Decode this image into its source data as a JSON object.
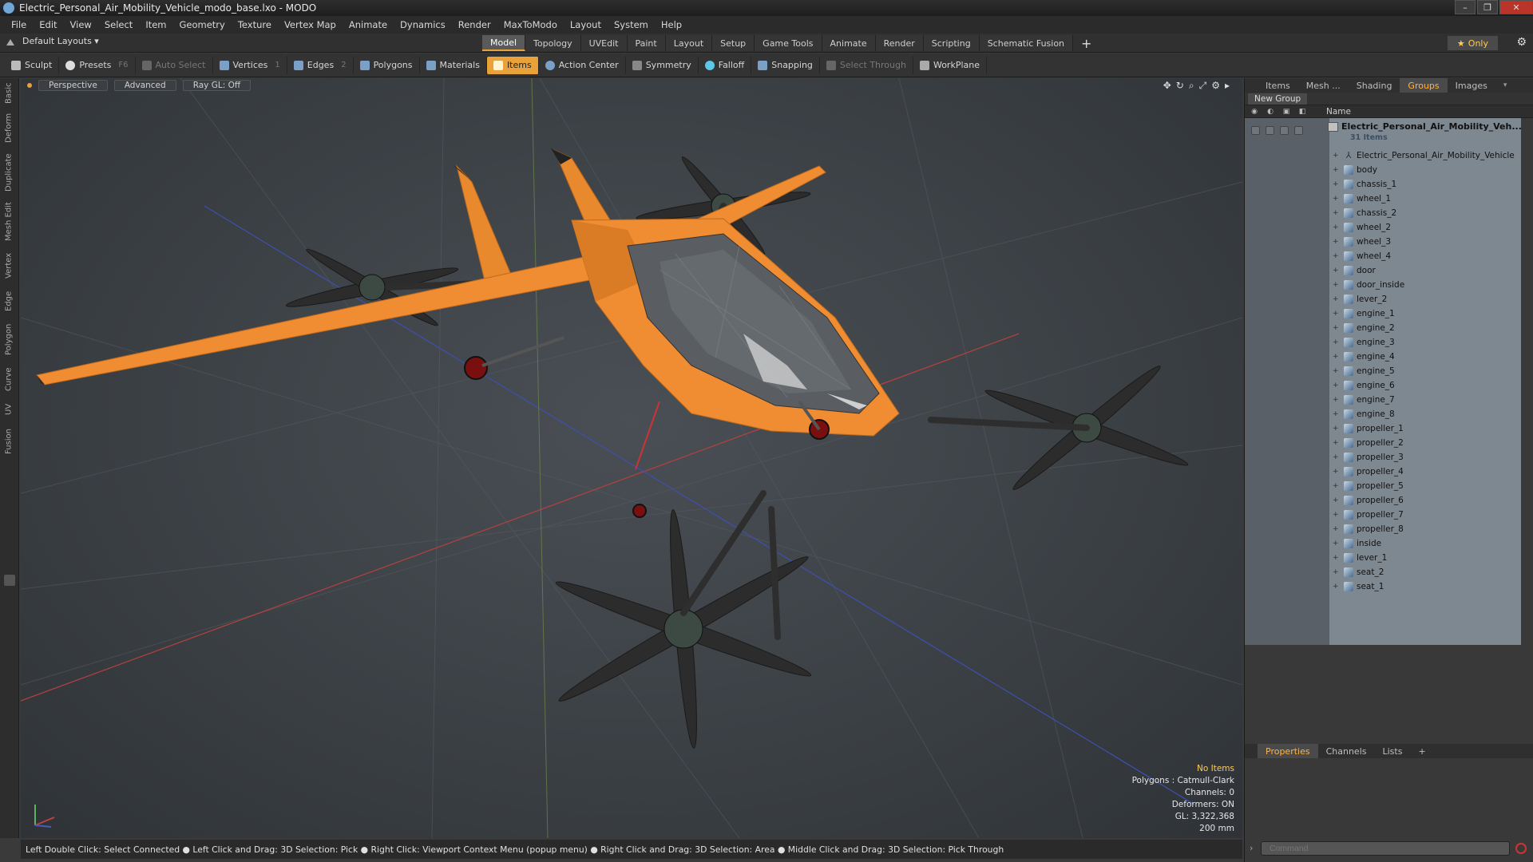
{
  "window": {
    "title": "Electric_Personal_Air_Mobility_Vehicle_modo_base.lxo - MODO"
  },
  "menu": [
    "File",
    "Edit",
    "View",
    "Select",
    "Item",
    "Geometry",
    "Texture",
    "Vertex Map",
    "Animate",
    "Dynamics",
    "Render",
    "MaxToModo",
    "Layout",
    "System",
    "Help"
  ],
  "layouts": {
    "label": "Default Layouts ▾"
  },
  "main_tabs": [
    "Model",
    "Topology",
    "UVEdit",
    "Paint",
    "Layout",
    "Setup",
    "Game Tools",
    "Animate",
    "Render",
    "Scripting",
    "Schematic Fusion"
  ],
  "active_tab": "Model",
  "only_label": "Only",
  "toolbar": {
    "sculpt": "Sculpt",
    "presets": "Presets",
    "presets_key": "F6",
    "auto_select": "Auto Select",
    "vertices": "Vertices",
    "vertices_key": "1",
    "edges": "Edges",
    "edges_key": "2",
    "polygons": "Polygons",
    "materials": "Materials",
    "items": "Items",
    "action_center": "Action Center",
    "symmetry": "Symmetry",
    "falloff": "Falloff",
    "snapping": "Snapping",
    "select_through": "Select Through",
    "workplane": "WorkPlane"
  },
  "left_tabs": [
    "Basic",
    "Deform",
    "Duplicate",
    "Mesh Edit",
    "Vertex",
    "Edge",
    "Polygon",
    "Curve",
    "UV",
    "Fusion"
  ],
  "viewport": {
    "view": "Perspective",
    "shading": "Advanced",
    "raygl": "Ray GL: Off",
    "stats": {
      "no_items": "No Items",
      "polygons": "Polygons : Catmull-Clark",
      "channels": "Channels: 0",
      "deformers": "Deformers: ON",
      "gl": "GL: 3,322,368",
      "scale": "200 mm"
    }
  },
  "status_bar": "Left Double Click: Select Connected ● Left Click and Drag: 3D Selection: Pick ● Right Click: Viewport Context Menu (popup menu) ● Right Click and Drag: 3D Selection: Area ● Middle Click and Drag: 3D Selection: Pick Through",
  "right_panel": {
    "tabs": [
      "Items",
      "Mesh ...",
      "Shading",
      "Groups",
      "Images"
    ],
    "active_tab": "Groups",
    "new_group": "New Group",
    "name_header": "Name",
    "group_name": "Electric_Personal_Air_Mobility_Veh...",
    "group_count": "31 Items",
    "items": [
      "Electric_Personal_Air_Mobility_Vehicle",
      "body",
      "chassis_1",
      "wheel_1",
      "chassis_2",
      "wheel_2",
      "wheel_3",
      "wheel_4",
      "door",
      "door_inside",
      "lever_2",
      "engine_1",
      "engine_2",
      "engine_3",
      "engine_4",
      "engine_5",
      "engine_6",
      "engine_7",
      "engine_8",
      "propeller_1",
      "propeller_2",
      "propeller_3",
      "propeller_4",
      "propeller_5",
      "propeller_6",
      "propeller_7",
      "propeller_8",
      "inside",
      "lever_1",
      "seat_2",
      "seat_1"
    ],
    "bottom_tabs": [
      "Properties",
      "Channels",
      "Lists"
    ],
    "bottom_active": "Properties",
    "command_placeholder": "Command"
  }
}
